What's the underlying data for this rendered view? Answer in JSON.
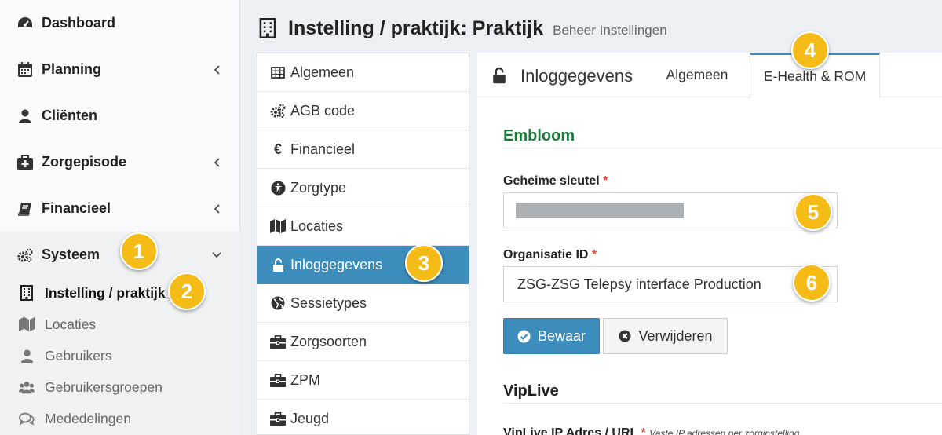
{
  "sidebar": {
    "items": [
      {
        "label": "Dashboard",
        "icon": "dashboard-icon"
      },
      {
        "label": "Planning",
        "icon": "calendar-icon"
      },
      {
        "label": "Cliënten",
        "icon": "user-icon"
      },
      {
        "label": "Zorgepisode",
        "icon": "medkit-icon"
      },
      {
        "label": "Financieel",
        "icon": "book-icon"
      },
      {
        "label": "Systeem",
        "icon": "cogs-icon"
      }
    ],
    "subitems": [
      {
        "label": "Instelling / praktijk",
        "icon": "building-icon"
      },
      {
        "label": "Locaties",
        "icon": "map-icon"
      },
      {
        "label": "Gebruikers",
        "icon": "user-icon"
      },
      {
        "label": "Gebruikersgroepen",
        "icon": "users-icon"
      },
      {
        "label": "Mededelingen",
        "icon": "comments-icon"
      }
    ]
  },
  "header": {
    "title": "Instelling / praktijk: Praktijk",
    "subtitle": "Beheer Instellingen"
  },
  "menu": {
    "items": [
      {
        "label": "Algemeen",
        "icon": "table-icon"
      },
      {
        "label": "AGB code",
        "icon": "cogs-icon"
      },
      {
        "label": "Financieel",
        "icon": "euro-icon"
      },
      {
        "label": "Zorgtype",
        "icon": "universal-access-icon"
      },
      {
        "label": "Locaties",
        "icon": "map-icon"
      },
      {
        "label": "Inloggegevens",
        "icon": "unlock-icon"
      },
      {
        "label": "Sessietypes",
        "icon": "globe-icon"
      },
      {
        "label": "Zorgsoorten",
        "icon": "briefcase-icon"
      },
      {
        "label": "ZPM",
        "icon": "briefcase-icon"
      },
      {
        "label": "Jeugd",
        "icon": "briefcase-icon"
      }
    ]
  },
  "panel": {
    "title": "Inloggegevens",
    "tabs": [
      "Algemeen",
      "E-Health & ROM"
    ],
    "section1": "Embloom",
    "field_secret_label": "Geheime sleutel",
    "field_org_label": "Organisatie ID",
    "required_mark": "*",
    "org_id_value": "ZSG-ZSG Telepsy interface Production",
    "save_label": "Bewaar",
    "delete_label": "Verwijderen",
    "section2": "VipLive",
    "viplive_label": "VipLive IP Adres / URL",
    "viplive_hint": "Vaste IP adressen per zorginstelling"
  },
  "badges": [
    "1",
    "2",
    "3",
    "4",
    "5",
    "6"
  ],
  "colors": {
    "accent": "#3c8dbc",
    "badge": "#f5bc17",
    "section_green": "#1e7a3c",
    "required": "#dd4b39"
  }
}
